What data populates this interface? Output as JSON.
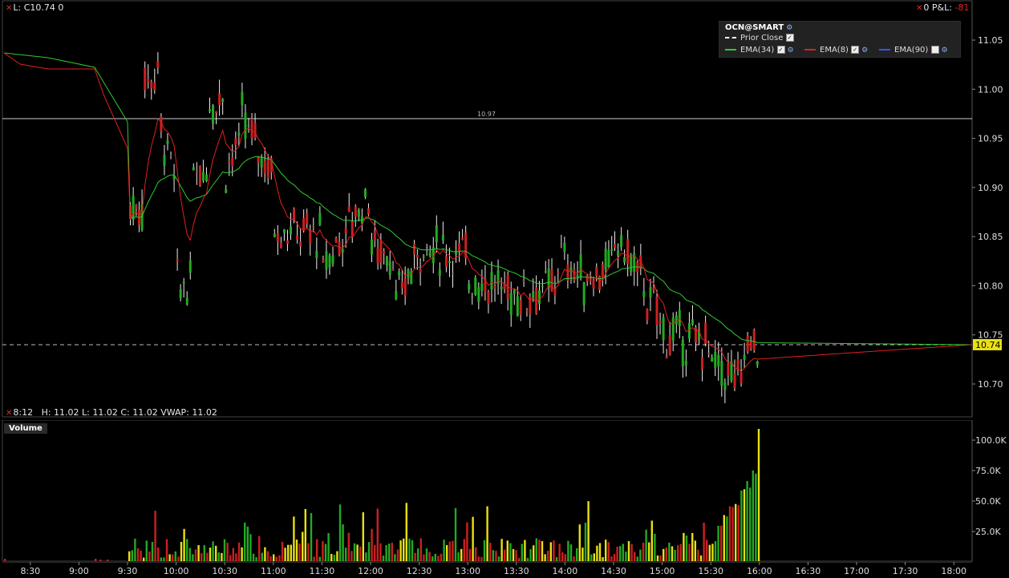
{
  "header": {
    "left_text": "L: C10.74 0",
    "right_prefix": "0 P&L:",
    "right_value": "-81"
  },
  "legend": {
    "title": "OCN@SMART",
    "items": [
      {
        "label": "Prior Close",
        "color": "#ffffff",
        "style": "dashed",
        "checked": true
      },
      {
        "label": "EMA(34)",
        "color": "#2ecc2e",
        "style": "solid",
        "checked": true
      },
      {
        "label": "EMA(8)",
        "color": "#e02020",
        "style": "solid",
        "checked": true
      },
      {
        "label": "EMA(90)",
        "color": "#3355ff",
        "style": "solid",
        "checked": false
      }
    ]
  },
  "price_axis": {
    "labels": [
      "11.05",
      "11.00",
      "10.95",
      "10.90",
      "10.85",
      "10.80",
      "10.75",
      "10.70"
    ],
    "current_price": "10.74",
    "current_price_color": "#e8e010"
  },
  "reference_line": {
    "label": "10.97"
  },
  "status_bar": {
    "text": "8:12   H: 11.02 L: 11.02 C: 11.02 VWAP: 11.02"
  },
  "volume_panel": {
    "title": "Volume",
    "labels": [
      "100.0K",
      "75.0K",
      "50.0K",
      "25.0K"
    ]
  },
  "time_axis": {
    "labels": [
      "8:30",
      "9:00",
      "9:30",
      "10:00",
      "10:30",
      "11:00",
      "11:30",
      "12:00",
      "12:30",
      "13:00",
      "13:30",
      "14:00",
      "14:30",
      "15:00",
      "15:30",
      "16:00",
      "16:30",
      "17:00",
      "17:30",
      "18:00"
    ]
  },
  "chart_data": {
    "type": "candlestick",
    "symbol": "OCN@SMART",
    "y_range": [
      10.67,
      11.07
    ],
    "prior_close": 10.74,
    "reference_level": 10.97,
    "candles_sampled": [
      {
        "t": "9:31",
        "o": 10.82,
        "h": 10.88,
        "l": 10.79,
        "c": 10.88
      },
      {
        "t": "9:40",
        "o": 10.88,
        "h": 11.04,
        "l": 10.86,
        "c": 11.01
      },
      {
        "t": "9:50",
        "o": 11.02,
        "h": 11.05,
        "l": 10.9,
        "c": 10.96
      },
      {
        "t": "10:00",
        "o": 10.9,
        "h": 10.92,
        "l": 10.77,
        "c": 10.8
      },
      {
        "t": "10:10",
        "o": 10.8,
        "h": 10.95,
        "l": 10.79,
        "c": 10.92
      },
      {
        "t": "10:20",
        "o": 10.92,
        "h": 11.01,
        "l": 10.9,
        "c": 10.99
      },
      {
        "t": "10:30",
        "o": 10.99,
        "h": 11.01,
        "l": 10.89,
        "c": 10.92
      },
      {
        "t": "10:40",
        "o": 10.95,
        "h": 11.0,
        "l": 10.92,
        "c": 10.97
      },
      {
        "t": "11:00",
        "o": 10.91,
        "h": 10.93,
        "l": 10.85,
        "c": 10.86
      },
      {
        "t": "11:30",
        "o": 10.85,
        "h": 10.87,
        "l": 10.78,
        "c": 10.82
      },
      {
        "t": "12:00",
        "o": 10.9,
        "h": 10.9,
        "l": 10.83,
        "c": 10.84
      },
      {
        "t": "12:15",
        "o": 10.83,
        "h": 10.85,
        "l": 10.77,
        "c": 10.78
      },
      {
        "t": "12:30",
        "o": 10.84,
        "h": 10.85,
        "l": 10.82,
        "c": 10.84
      },
      {
        "t": "13:00",
        "o": 10.83,
        "h": 10.84,
        "l": 10.81,
        "c": 10.81
      },
      {
        "t": "13:30",
        "o": 10.79,
        "h": 10.8,
        "l": 10.72,
        "c": 10.79
      },
      {
        "t": "13:55",
        "o": 10.8,
        "h": 10.87,
        "l": 10.78,
        "c": 10.83
      },
      {
        "t": "14:15",
        "o": 10.8,
        "h": 10.82,
        "l": 10.78,
        "c": 10.81
      },
      {
        "t": "14:30",
        "o": 10.82,
        "h": 10.86,
        "l": 10.81,
        "c": 10.85
      },
      {
        "t": "14:50",
        "o": 10.8,
        "h": 10.81,
        "l": 10.77,
        "c": 10.78
      },
      {
        "t": "15:00",
        "o": 10.77,
        "h": 10.78,
        "l": 10.73,
        "c": 10.75
      },
      {
        "t": "15:30",
        "o": 10.74,
        "h": 10.75,
        "l": 10.71,
        "c": 10.72
      },
      {
        "t": "15:50",
        "o": 10.7,
        "h": 10.74,
        "l": 10.69,
        "c": 10.74
      },
      {
        "t": "16:00",
        "o": 10.74,
        "h": 10.74,
        "l": 10.74,
        "c": 10.74
      }
    ]
  }
}
